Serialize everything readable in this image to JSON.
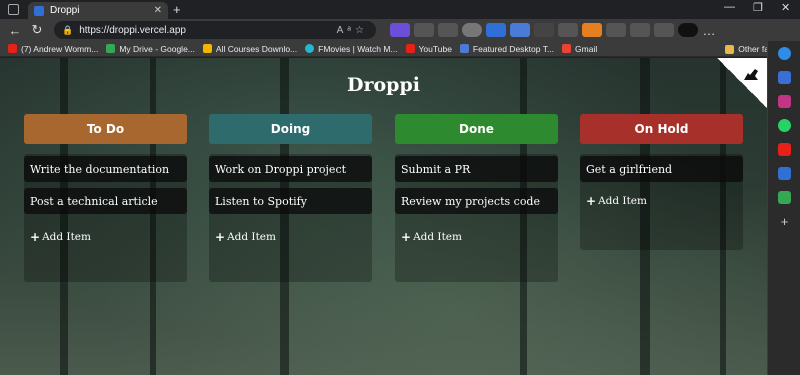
{
  "browser": {
    "tab_title": "Droppi",
    "url": "https://droppi.vercel.app",
    "bookmarks": [
      {
        "label": "(7) Andrew Womm...",
        "color": "#e62117"
      },
      {
        "label": "My Drive - Google...",
        "color": "#34a853"
      },
      {
        "label": "All Courses Downlo...",
        "color": "#f4b400"
      },
      {
        "label": "FMovies | Watch M...",
        "color": "#22b8cf"
      },
      {
        "label": "YouTube",
        "color": "#e62117"
      },
      {
        "label": "Featured Desktop T...",
        "color": "#4a7bd6"
      },
      {
        "label": "Gmail",
        "color": "#ea4335"
      }
    ],
    "other_favorites": "Other favorites"
  },
  "app": {
    "title": "Droppi",
    "columns": [
      {
        "title": "To Do",
        "color": "#a8672e",
        "items": [
          "Write the documentation",
          "Post a technical article"
        ],
        "add_label": "Add Item"
      },
      {
        "title": "Doing",
        "color": "#2e6b6d",
        "items": [
          "Work on Droppi project",
          "Listen to Spotify"
        ],
        "add_label": "Add Item"
      },
      {
        "title": "Done",
        "color": "#2e8a2e",
        "items": [
          "Submit a PR",
          "Review my projects code"
        ],
        "add_label": "Add Item"
      },
      {
        "title": "On Hold",
        "color": "#a8302a",
        "items": [
          "Get a girlfriend"
        ],
        "add_label": "Add Item"
      }
    ]
  }
}
